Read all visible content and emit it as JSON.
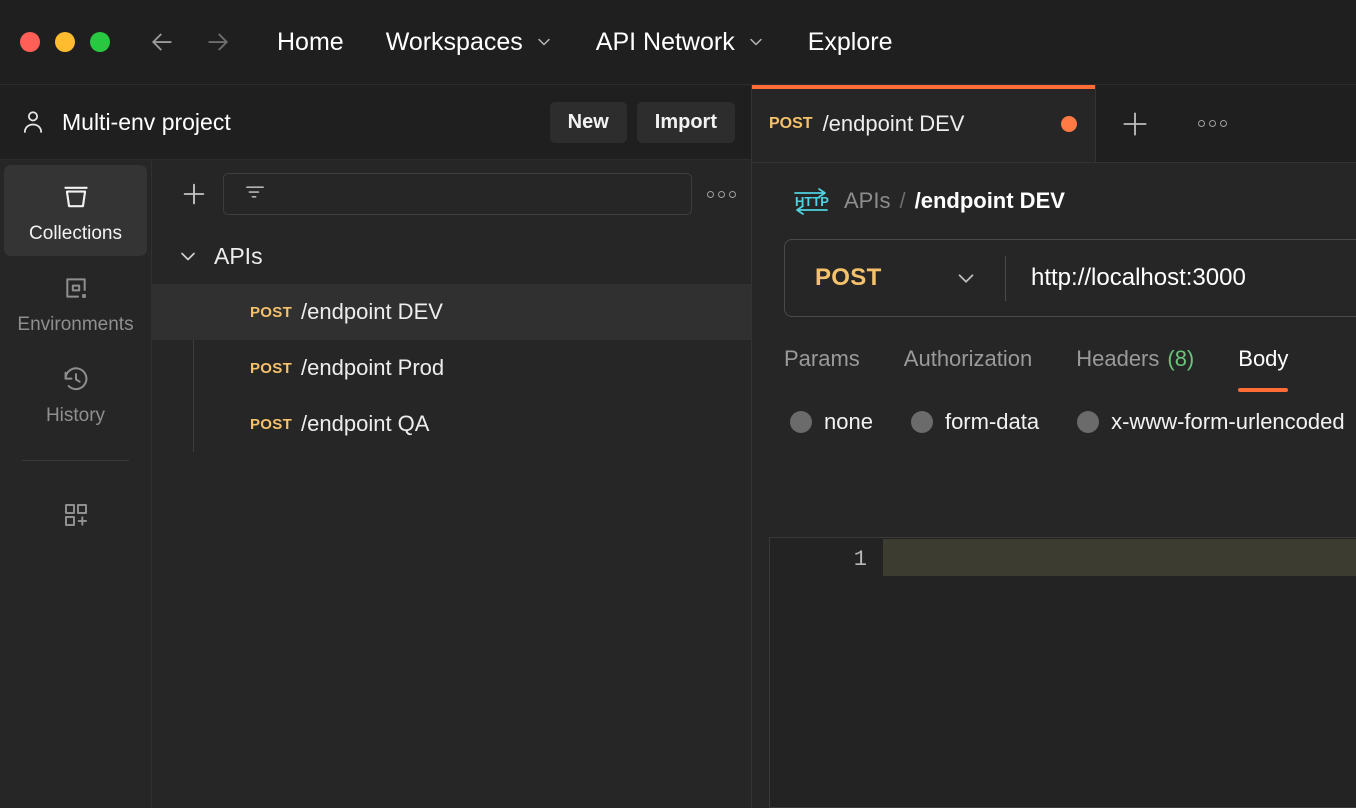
{
  "topnav": {
    "back_icon": "arrow-left-icon",
    "forward_icon": "arrow-right-icon",
    "items": [
      {
        "label": "Home",
        "has_chevron": false
      },
      {
        "label": "Workspaces",
        "has_chevron": true
      },
      {
        "label": "API Network",
        "has_chevron": true
      },
      {
        "label": "Explore",
        "has_chevron": false
      }
    ]
  },
  "workspace": {
    "title": "Multi-env project",
    "avatar_icon": "person-icon",
    "new_label": "New",
    "import_label": "Import"
  },
  "rail": {
    "items": [
      {
        "label": "Collections",
        "icon": "collections-icon",
        "active": true
      },
      {
        "label": "Environments",
        "icon": "environments-icon",
        "active": false
      },
      {
        "label": "History",
        "icon": "history-icon",
        "active": false
      }
    ],
    "add_module_icon": "add-module-icon"
  },
  "collection_panel": {
    "add_icon": "plus-icon",
    "filter_icon": "filter-icon",
    "filter_value": "",
    "filter_placeholder": "",
    "more_icon": "more-horizontal-icon",
    "tree": {
      "folder": {
        "name": "APIs",
        "expanded": true,
        "chevron_icon": "chevron-down-icon"
      },
      "requests": [
        {
          "method": "POST",
          "name": "/endpoint DEV",
          "selected": true
        },
        {
          "method": "POST",
          "name": "/endpoint Prod",
          "selected": false
        },
        {
          "method": "POST",
          "name": "/endpoint QA",
          "selected": false
        }
      ]
    }
  },
  "right_pane": {
    "tabs": [
      {
        "method": "POST",
        "name": "/endpoint DEV",
        "active": true,
        "unsaved": true
      }
    ],
    "new_tab_icon": "plus-icon",
    "tab_more_icon": "more-horizontal-icon",
    "breadcrumb": {
      "type_icon": "http-icon",
      "root": "APIs",
      "separator": "/",
      "current": "/endpoint DEV"
    },
    "url_bar": {
      "method": "POST",
      "method_chevron_icon": "chevron-down-icon",
      "url": "http://localhost:3000"
    },
    "request_tabs": [
      {
        "label": "Params",
        "count": "",
        "active": false
      },
      {
        "label": "Authorization",
        "count": "",
        "active": false
      },
      {
        "label": "Headers",
        "count": "(8)",
        "active": false
      },
      {
        "label": "Body",
        "count": "",
        "active": true
      }
    ],
    "body_types": [
      {
        "label": "none",
        "selected": false
      },
      {
        "label": "form-data",
        "selected": false
      },
      {
        "label": "x-www-form-urlencoded",
        "selected": false
      }
    ],
    "editor": {
      "line_number": "1",
      "content": ""
    }
  },
  "colors": {
    "accent": "#ff6c37",
    "method_post": "#f5c26b",
    "count_green": "#6ac47a",
    "http_icon": "#4fd1e0",
    "active_line": "#3d3c30",
    "panel_bg": "#262626",
    "chrome_bg": "#1f1f1f"
  }
}
